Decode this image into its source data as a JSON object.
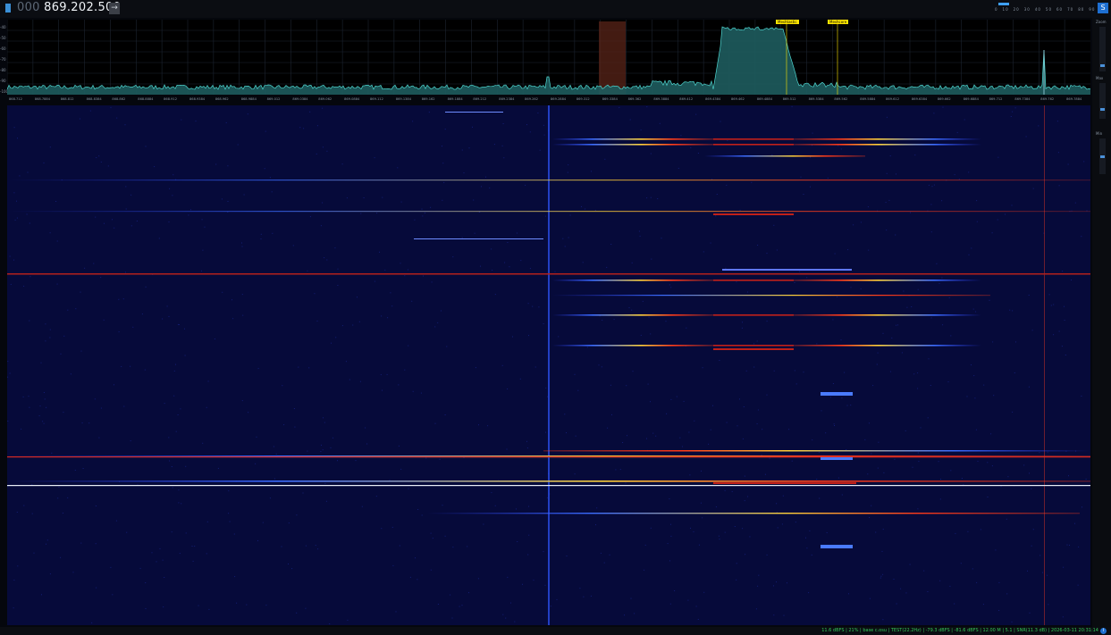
{
  "header": {
    "menu_icon": "menu-icon",
    "frequency_lead": "000",
    "frequency_main": "869.202.500",
    "go_button_label": "→",
    "scale_labels": [
      "0",
      "10",
      "20",
      "30",
      "40",
      "50",
      "60",
      "70",
      "80",
      "90"
    ],
    "logo_label": "S"
  },
  "spectrum": {
    "y_labels": [
      "-40",
      "-50",
      "-60",
      "-70",
      "-80",
      "-90",
      "-100"
    ],
    "freq_tick_labels": [
      "868.712",
      "868.7884",
      "868.812",
      "868.8384",
      "868.862",
      "868.8884",
      "868.912",
      "868.9384",
      "868.962",
      "868.9884",
      "869.012",
      "869.0384",
      "869.062",
      "869.0884",
      "869.112",
      "869.1384",
      "869.162",
      "869.1884",
      "869.212",
      "869.2384",
      "869.262",
      "869.2884",
      "869.312",
      "869.3384",
      "869.362",
      "869.3884",
      "869.412",
      "869.4384",
      "869.462",
      "869.4884",
      "869.512",
      "869.5384",
      "869.562",
      "869.5884",
      "869.612",
      "869.6384",
      "869.662",
      "869.6884",
      "869.712",
      "869.7384",
      "869.762",
      "869.7884"
    ],
    "markers": [
      {
        "label": "Meshtastic"
      },
      {
        "label": "Meshcore"
      }
    ],
    "colors": {
      "trace": "#4ed6d0",
      "fill": "#1e5c5e",
      "accent": "#ffe600"
    }
  },
  "side": {
    "labels": [
      "Zoom",
      "Max",
      "Min"
    ]
  },
  "status": {
    "text": "11.6 dBFS | 21% | base c.osu | TEST(22.2Hz) | -79.3 dBFS | -81.6 dBFS | 12.00 M | 5.1 | SNR(11.3 dB) | 2026-03-11 20:31:14",
    "icon": "info-icon"
  }
}
